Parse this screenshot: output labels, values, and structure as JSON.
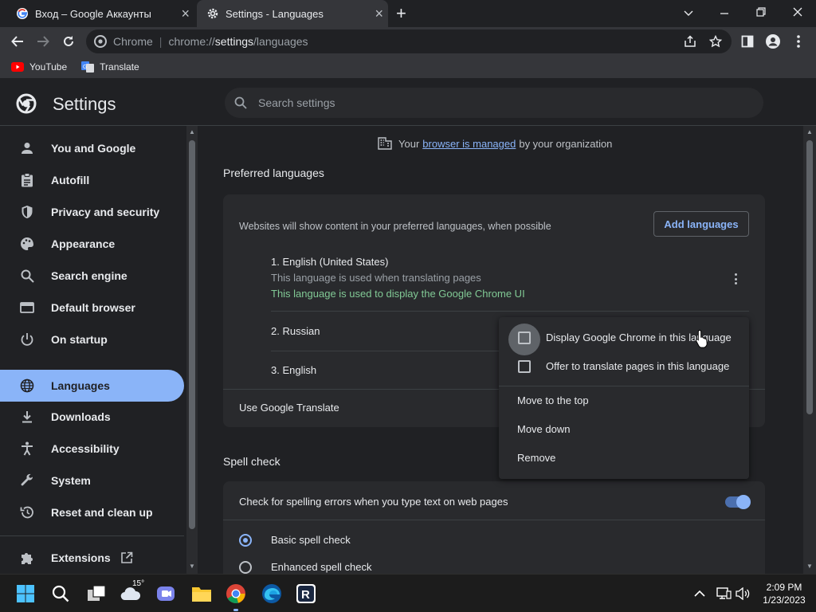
{
  "tabs": [
    {
      "title": "Вход – Google Аккаунты"
    },
    {
      "title": "Settings - Languages"
    }
  ],
  "omnibox": {
    "site_label": "Chrome",
    "url_scheme": "chrome://",
    "url_host": "settings",
    "url_path": "/languages"
  },
  "bookmarks": [
    {
      "label": "YouTube",
      "icon": "youtube-icon"
    },
    {
      "label": "Translate",
      "icon": "google-translate-icon"
    }
  ],
  "settings": {
    "title": "Settings",
    "search_placeholder": "Search settings"
  },
  "sidebar": {
    "items": [
      {
        "label": "You and Google",
        "icon": "person-icon"
      },
      {
        "label": "Autofill",
        "icon": "clipboard-icon"
      },
      {
        "label": "Privacy and security",
        "icon": "shield-icon"
      },
      {
        "label": "Appearance",
        "icon": "palette-icon"
      },
      {
        "label": "Search engine",
        "icon": "search-icon"
      },
      {
        "label": "Default browser",
        "icon": "browser-window-icon"
      },
      {
        "label": "On startup",
        "icon": "power-icon"
      },
      {
        "label": "Languages",
        "icon": "globe-icon",
        "active": true
      },
      {
        "label": "Downloads",
        "icon": "download-icon"
      },
      {
        "label": "Accessibility",
        "icon": "accessibility-icon"
      },
      {
        "label": "System",
        "icon": "wrench-icon"
      },
      {
        "label": "Reset and clean up",
        "icon": "history-icon"
      },
      {
        "label": "Extensions",
        "icon": "puzzle-icon"
      }
    ]
  },
  "main": {
    "managed": {
      "prefix": "Your",
      "link": "browser is managed",
      "suffix": "by your organization"
    },
    "preferred_title": "Preferred languages",
    "card_description": "Websites will show content in your preferred languages, when possible",
    "add_languages": "Add languages",
    "languages": [
      {
        "label": "1. English (United States)",
        "sub": "This language is used when translating pages",
        "note": "This language is used to display the Google Chrome UI"
      },
      {
        "label": "2. Russian"
      },
      {
        "label": "3. English"
      }
    ],
    "use_translate": "Use Google Translate",
    "spell_title": "Spell check",
    "spell_text": "Check for spelling errors when you type text on web pages",
    "spell_enabled": true,
    "spell_options": [
      {
        "label": "Basic spell check",
        "selected": true
      },
      {
        "label": "Enhanced spell check",
        "selected": false
      }
    ]
  },
  "context_menu": {
    "checkboxes": [
      {
        "label": "Display Google Chrome in this language",
        "checked": false
      },
      {
        "label": "Offer to translate pages in this language",
        "checked": false
      }
    ],
    "items": [
      {
        "label": "Move to the top"
      },
      {
        "label": "Move down"
      },
      {
        "label": "Remove"
      }
    ]
  },
  "taskbar": {
    "weather_temp": "15°",
    "time": "2:09 PM",
    "date": "1/23/2023"
  },
  "colors": {
    "accent": "#8ab4f8",
    "background": "#202124",
    "surface": "#292a2d",
    "green_note": "#81c995"
  }
}
